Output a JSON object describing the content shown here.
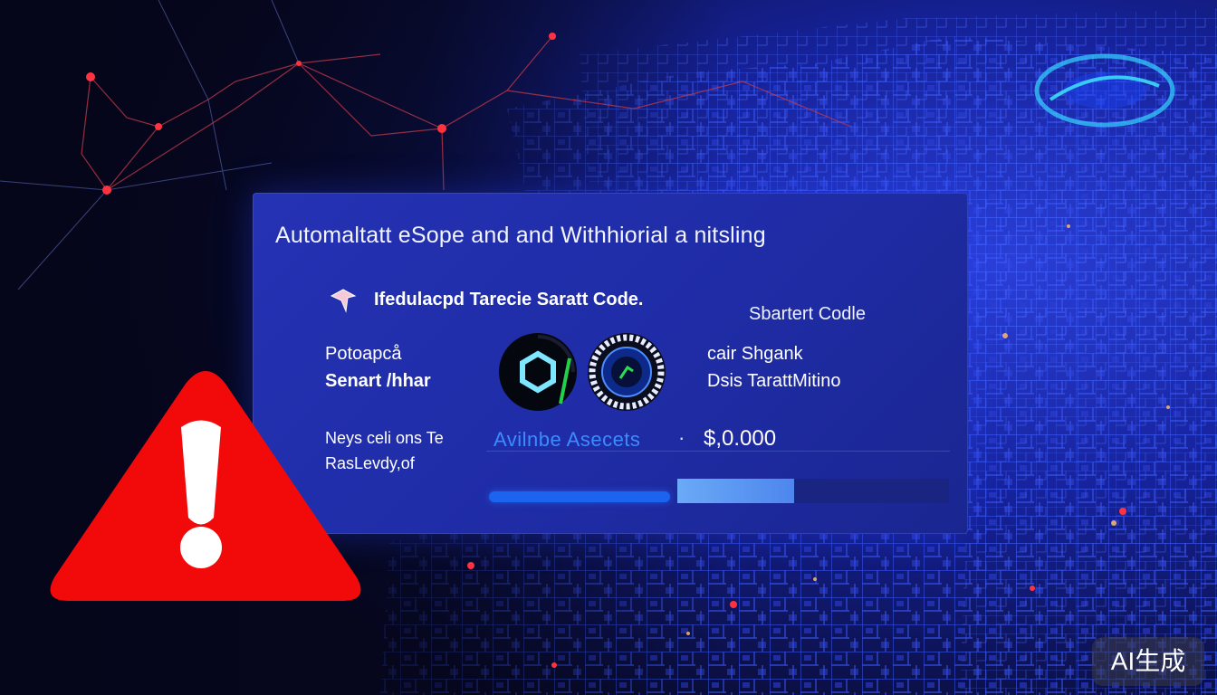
{
  "panel": {
    "title": "Automaltatt eSope and and Withhiorial a nitsling",
    "contract_label": "Ifedulacpd Tarecie Saratt Code.",
    "smart_code": "Sbartert Codle",
    "left_top_line1": "Potoapcå",
    "left_top_line2": "Senart /hhar",
    "right_line1": "cair Shgank",
    "right_line2": "Dsis TarattMitino",
    "left_bottom_line1": "Neys celi ons Te",
    "left_bottom_line2": "RasLevdy,of",
    "assets_label": "Avilnbe Asecets",
    "separator": "·",
    "amount": "$,0.000",
    "progress": 0.43
  },
  "icons": {
    "contract": "arrow-icon",
    "token_1": "hexagon-token-icon",
    "token_2": "gauge-token-icon",
    "warning": "warning-triangle-icon"
  },
  "colors": {
    "panel": "#2230b0",
    "warning": "#f20a0a",
    "accent": "#3b8cff"
  },
  "watermark": "AI生成"
}
